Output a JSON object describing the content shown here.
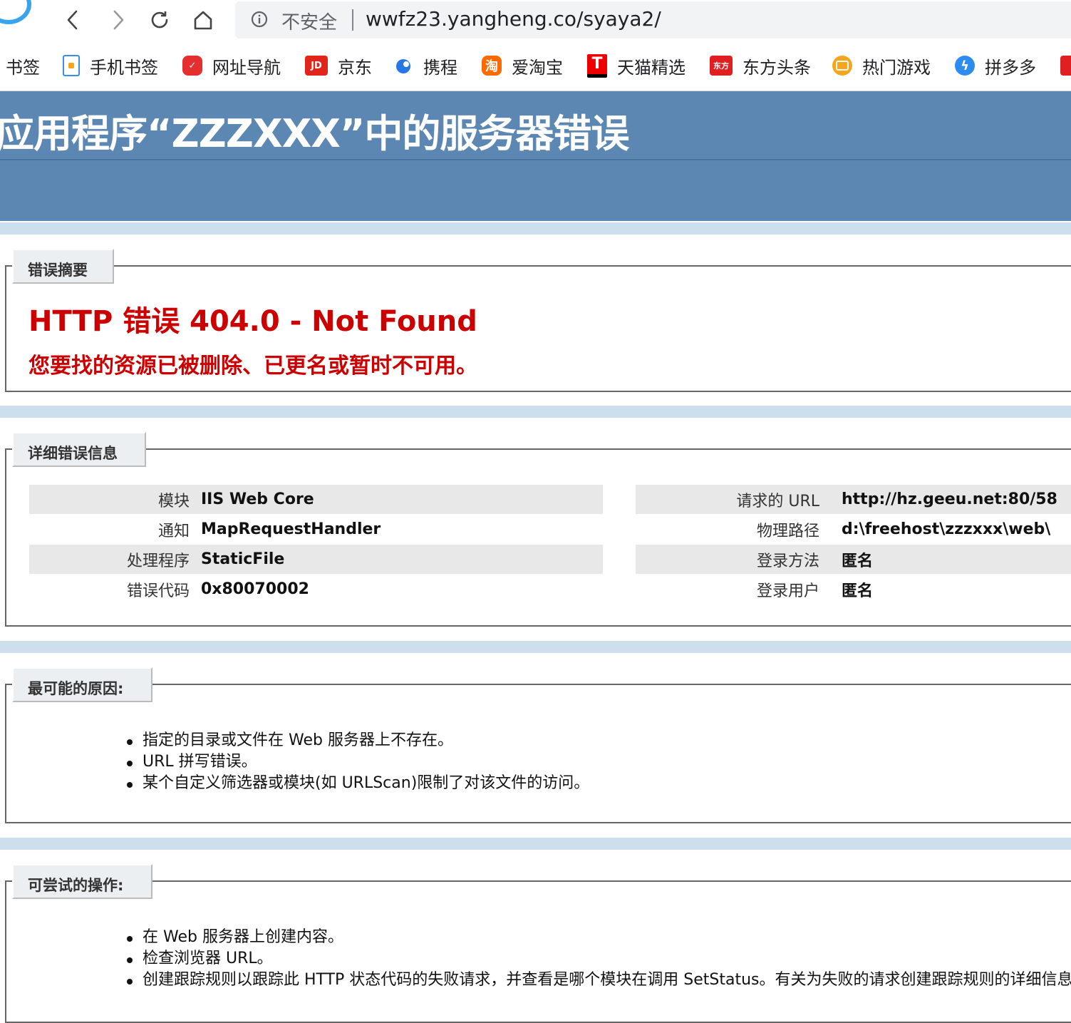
{
  "browser": {
    "security_label": "不安全",
    "url": "wwfz23.yangheng.co/syaya2/"
  },
  "bookmarks": [
    {
      "label": "书签",
      "icon": "bookmark-icon"
    },
    {
      "label": "手机书签",
      "icon": "phone-bookmark-icon",
      "color": "#3a8ee6"
    },
    {
      "label": "网址导航",
      "icon": "navigation-icon",
      "color": "#e52e2e"
    },
    {
      "label": "京东",
      "icon": "jd-icon",
      "color": "#e1251b",
      "icon_text": "JD"
    },
    {
      "label": "携程",
      "icon": "ctrip-icon",
      "color": "#2577e3"
    },
    {
      "label": "爱淘宝",
      "icon": "taobao-icon",
      "color": "#ff6a00",
      "icon_text": "淘"
    },
    {
      "label": "天猫精选",
      "icon": "tmall-icon",
      "color": "#e00",
      "icon_text": "T"
    },
    {
      "label": "东方头条",
      "icon": "dftoutiao-icon",
      "color": "#e02020",
      "icon_text": "东方"
    },
    {
      "label": "热门游戏",
      "icon": "games-icon",
      "color": "#f7a51c"
    },
    {
      "label": "拼多多",
      "icon": "pinduoduo-icon",
      "color": "#2d8cf0"
    }
  ],
  "page": {
    "title": "应用程序“ZZZXXX”中的服务器错误",
    "summary": {
      "heading": "错误摘要",
      "error_title": "HTTP 错误 404.0 - Not Found",
      "error_desc": "您要找的资源已被删除、已更名或暂时不可用。"
    },
    "details": {
      "heading": "详细错误信息",
      "left": [
        {
          "key": "模块",
          "value": "IIS Web Core"
        },
        {
          "key": "通知",
          "value": "MapRequestHandler"
        },
        {
          "key": "处理程序",
          "value": "StaticFile"
        },
        {
          "key": "错误代码",
          "value": "0x80070002"
        }
      ],
      "right": [
        {
          "key": "请求的 URL",
          "value": "http://hz.geeu.net:80/58"
        },
        {
          "key": "物理路径",
          "value": "d:\\freehost\\zzzxxx\\web\\"
        },
        {
          "key": "登录方法",
          "value": "匿名"
        },
        {
          "key": "登录用户",
          "value": "匿名"
        }
      ]
    },
    "causes": {
      "heading": "最可能的原因:",
      "items": [
        "指定的目录或文件在 Web 服务器上不存在。",
        "URL 拼写错误。",
        "某个自定义筛选器或模块(如 URLScan)限制了对该文件的访问。"
      ]
    },
    "actions": {
      "heading": "可尝试的操作:",
      "items": [
        "在 Web 服务器上创建内容。",
        "检查浏览器 URL。",
        "创建跟踪规则以跟踪此 HTTP 状态代码的失败请求，并查看是哪个模块在调用 SetStatus。有关为失败的请求创建跟踪规则的详细信息"
      ]
    }
  }
}
